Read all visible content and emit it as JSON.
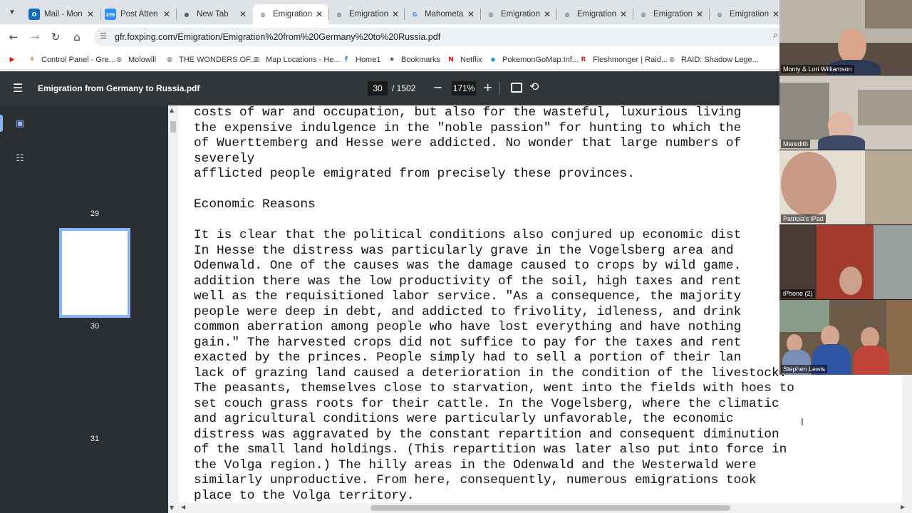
{
  "tabs": [
    {
      "title": "Mail - Mon",
      "favicon": "outlook-icon",
      "color": "#0f6cbd",
      "glyph": "O"
    },
    {
      "title": "Post Atten",
      "favicon": "zoom-icon",
      "color": "#2d8cff",
      "glyph": "zm"
    },
    {
      "title": "New Tab",
      "favicon": "chrome-icon",
      "color": "#5f6368",
      "glyph": "●"
    },
    {
      "title": "Emigration",
      "favicon": "globe-icon",
      "color": "#5f6368",
      "glyph": "◍",
      "active": true
    },
    {
      "title": "Emigration",
      "favicon": "globe-icon",
      "color": "#5f6368",
      "glyph": "◍"
    },
    {
      "title": "Mahometa",
      "favicon": "google-icon",
      "color": "#4285f4",
      "glyph": "G"
    },
    {
      "title": "Emigration",
      "favicon": "globe-icon",
      "color": "#5f6368",
      "glyph": "◍"
    },
    {
      "title": "Emigration",
      "favicon": "globe-icon",
      "color": "#5f6368",
      "glyph": "◍"
    },
    {
      "title": "Emigration",
      "favicon": "globe-icon",
      "color": "#5f6368",
      "glyph": "◍"
    },
    {
      "title": "Emigration",
      "favicon": "globe-icon",
      "color": "#5f6368",
      "glyph": "◍"
    }
  ],
  "address": {
    "url": "gfr.foxping.com/Emigration/Emigration%20from%20Germany%20to%20Russia.pdf"
  },
  "bookmarks": [
    {
      "label": "",
      "icon": "youtube-icon",
      "color": "#ff0000",
      "glyph": "▶"
    },
    {
      "label": "Control Panel - Gre...",
      "icon": "control-panel-icon",
      "color": "#b07a00",
      "glyph": "⚘"
    },
    {
      "label": "Molowill",
      "icon": "globe-icon",
      "color": "#5f6368",
      "glyph": "◍"
    },
    {
      "label": "THE WONDERS OF...",
      "icon": "globe-icon",
      "color": "#5f6368",
      "glyph": "◍"
    },
    {
      "label": "Map Locations - He...",
      "icon": "map-icon",
      "color": "#444444",
      "glyph": "▥"
    },
    {
      "label": "Home1",
      "icon": "facebook-icon",
      "color": "#1877f2",
      "glyph": "f"
    },
    {
      "label": "Bookmarks",
      "icon": "star-icon",
      "color": "#444444",
      "glyph": "★"
    },
    {
      "label": "Netflix",
      "icon": "netflix-icon",
      "color": "#e50914",
      "glyph": "N"
    },
    {
      "label": "PokemonGoMap.Inf...",
      "icon": "cube-icon",
      "color": "#1a9fd8",
      "glyph": "◆"
    },
    {
      "label": "Fleshmonger | Raid...",
      "icon": "raid-icon",
      "color": "#d32f2f",
      "glyph": "R"
    },
    {
      "label": "RAID: Shadow Lege...",
      "icon": "globe-icon",
      "color": "#5f6368",
      "glyph": "◍"
    }
  ],
  "pdf": {
    "title": "Emigration from Germany to Russia.pdf",
    "page": "30",
    "total": "/ 1502",
    "zoom": "171%",
    "thumb_labels": [
      "29",
      "30",
      "31"
    ]
  },
  "document": {
    "lines": [
      "costs of war and occupation, but also for the wasteful, luxurious living",
      "the expensive indulgence in the \"noble passion\" for hunting to which the",
      "of Wuerttemberg and Hesse were addicted. No wonder that large numbers of",
      "severely",
      "afflicted people emigrated from precisely these provinces.",
      "",
      "Economic Reasons",
      "",
      "It is clear that the political conditions also conjured up economic dist",
      "In Hesse the distress was particularly grave in the Vogelsberg area and",
      "Odenwald. One of the causes was the damage caused to crops by wild game.",
      "addition there was the low productivity of the soil, high taxes and rent",
      "well as the requisitioned labor service. \"As a consequence, the majority",
      "people were deep in debt, and addicted to frivolity, idleness, and drink",
      "common aberration among people who have lost everything and have nothing",
      "gain.\" The harvested crops did not suffice to pay for the taxes and rent",
      "exacted by the princes. People simply had to sell a portion of their lan",
      "lack of grazing land caused a deterioration in the condition of the livestock.",
      "The peasants, themselves close to starvation, went into the fields with hoes to",
      "set couch grass roots for their cattle. In the Vogelsberg, where the climatic",
      "and agricultural conditions were particularly unfavorable, the economic",
      "distress was aggravated by the constant repartition and consequent diminution",
      "of the small land holdings. (This repartition was later also put into force in",
      "the Volga region.) The hilly areas in the Odenwald and the Westerwald were",
      "similarly unproductive. From here, consequently, numerous emigrations took",
      "place to the Volga territory."
    ]
  },
  "participants": [
    {
      "name": "Monty & Lori Williamson"
    },
    {
      "name": "Meredith"
    },
    {
      "name": "Patricia's iPad"
    },
    {
      "name": "iPhone (2)"
    },
    {
      "name": "Stephen Lewis"
    }
  ]
}
